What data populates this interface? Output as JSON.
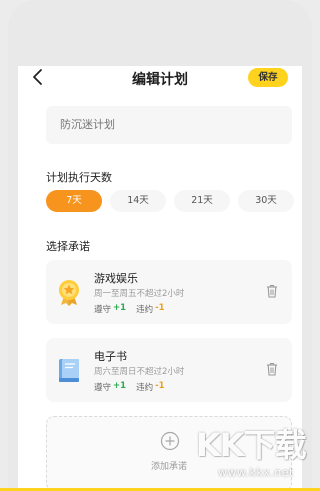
{
  "header": {
    "title": "编辑计划",
    "save_label": "保存"
  },
  "plan_name": {
    "placeholder": "防沉迷计划"
  },
  "days_section": {
    "label": "计划执行天数",
    "options": [
      "7天",
      "14天",
      "21天",
      "30天"
    ],
    "selected": "7天"
  },
  "commitments": {
    "label": "选择承诺",
    "items": [
      {
        "title": "游戏娱乐",
        "desc": "周一至周五不超过2小时",
        "keep_label": "遵守",
        "keep_value": "+1",
        "break_label": "违约",
        "break_value": "-1",
        "icon": "medal-icon"
      },
      {
        "title": "电子书",
        "desc": "周六至周日不超过2小时",
        "keep_label": "遵守",
        "keep_value": "+1",
        "break_label": "违约",
        "break_value": "-1",
        "icon": "book-icon"
      }
    ],
    "add_label": "添加承诺"
  },
  "watermark": {
    "logo": "KK下载",
    "url": "www.kkx.net"
  },
  "colors": {
    "accent_yellow": "#ffd21e",
    "selected_orange": "#f7941d",
    "keep_green": "#2fa84f",
    "break_orange": "#e8a21a"
  }
}
